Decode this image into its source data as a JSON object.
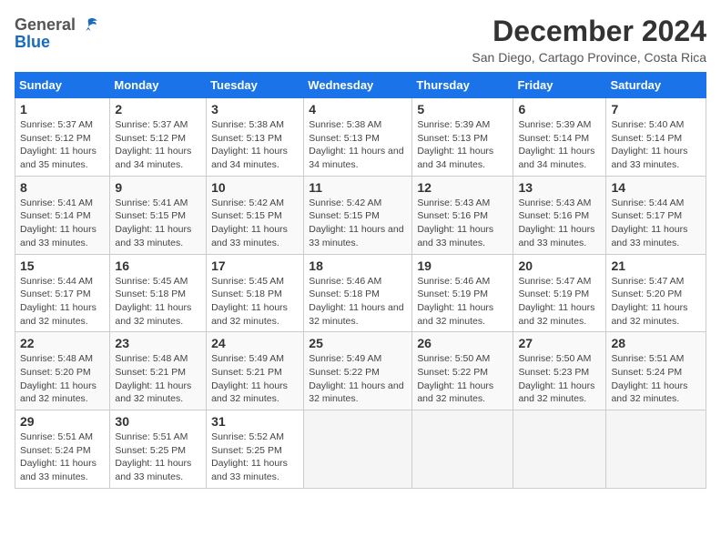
{
  "header": {
    "logo_line1": "General",
    "logo_line2": "Blue",
    "title": "December 2024",
    "subtitle": "San Diego, Cartago Province, Costa Rica"
  },
  "calendar": {
    "days_of_week": [
      "Sunday",
      "Monday",
      "Tuesday",
      "Wednesday",
      "Thursday",
      "Friday",
      "Saturday"
    ],
    "weeks": [
      [
        {
          "day": "1",
          "sunrise": "Sunrise: 5:37 AM",
          "sunset": "Sunset: 5:12 PM",
          "daylight": "Daylight: 11 hours and 35 minutes."
        },
        {
          "day": "2",
          "sunrise": "Sunrise: 5:37 AM",
          "sunset": "Sunset: 5:12 PM",
          "daylight": "Daylight: 11 hours and 34 minutes."
        },
        {
          "day": "3",
          "sunrise": "Sunrise: 5:38 AM",
          "sunset": "Sunset: 5:13 PM",
          "daylight": "Daylight: 11 hours and 34 minutes."
        },
        {
          "day": "4",
          "sunrise": "Sunrise: 5:38 AM",
          "sunset": "Sunset: 5:13 PM",
          "daylight": "Daylight: 11 hours and 34 minutes."
        },
        {
          "day": "5",
          "sunrise": "Sunrise: 5:39 AM",
          "sunset": "Sunset: 5:13 PM",
          "daylight": "Daylight: 11 hours and 34 minutes."
        },
        {
          "day": "6",
          "sunrise": "Sunrise: 5:39 AM",
          "sunset": "Sunset: 5:14 PM",
          "daylight": "Daylight: 11 hours and 34 minutes."
        },
        {
          "day": "7",
          "sunrise": "Sunrise: 5:40 AM",
          "sunset": "Sunset: 5:14 PM",
          "daylight": "Daylight: 11 hours and 33 minutes."
        }
      ],
      [
        {
          "day": "8",
          "sunrise": "Sunrise: 5:41 AM",
          "sunset": "Sunset: 5:14 PM",
          "daylight": "Daylight: 11 hours and 33 minutes."
        },
        {
          "day": "9",
          "sunrise": "Sunrise: 5:41 AM",
          "sunset": "Sunset: 5:15 PM",
          "daylight": "Daylight: 11 hours and 33 minutes."
        },
        {
          "day": "10",
          "sunrise": "Sunrise: 5:42 AM",
          "sunset": "Sunset: 5:15 PM",
          "daylight": "Daylight: 11 hours and 33 minutes."
        },
        {
          "day": "11",
          "sunrise": "Sunrise: 5:42 AM",
          "sunset": "Sunset: 5:15 PM",
          "daylight": "Daylight: 11 hours and 33 minutes."
        },
        {
          "day": "12",
          "sunrise": "Sunrise: 5:43 AM",
          "sunset": "Sunset: 5:16 PM",
          "daylight": "Daylight: 11 hours and 33 minutes."
        },
        {
          "day": "13",
          "sunrise": "Sunrise: 5:43 AM",
          "sunset": "Sunset: 5:16 PM",
          "daylight": "Daylight: 11 hours and 33 minutes."
        },
        {
          "day": "14",
          "sunrise": "Sunrise: 5:44 AM",
          "sunset": "Sunset: 5:17 PM",
          "daylight": "Daylight: 11 hours and 33 minutes."
        }
      ],
      [
        {
          "day": "15",
          "sunrise": "Sunrise: 5:44 AM",
          "sunset": "Sunset: 5:17 PM",
          "daylight": "Daylight: 11 hours and 32 minutes."
        },
        {
          "day": "16",
          "sunrise": "Sunrise: 5:45 AM",
          "sunset": "Sunset: 5:18 PM",
          "daylight": "Daylight: 11 hours and 32 minutes."
        },
        {
          "day": "17",
          "sunrise": "Sunrise: 5:45 AM",
          "sunset": "Sunset: 5:18 PM",
          "daylight": "Daylight: 11 hours and 32 minutes."
        },
        {
          "day": "18",
          "sunrise": "Sunrise: 5:46 AM",
          "sunset": "Sunset: 5:18 PM",
          "daylight": "Daylight: 11 hours and 32 minutes."
        },
        {
          "day": "19",
          "sunrise": "Sunrise: 5:46 AM",
          "sunset": "Sunset: 5:19 PM",
          "daylight": "Daylight: 11 hours and 32 minutes."
        },
        {
          "day": "20",
          "sunrise": "Sunrise: 5:47 AM",
          "sunset": "Sunset: 5:19 PM",
          "daylight": "Daylight: 11 hours and 32 minutes."
        },
        {
          "day": "21",
          "sunrise": "Sunrise: 5:47 AM",
          "sunset": "Sunset: 5:20 PM",
          "daylight": "Daylight: 11 hours and 32 minutes."
        }
      ],
      [
        {
          "day": "22",
          "sunrise": "Sunrise: 5:48 AM",
          "sunset": "Sunset: 5:20 PM",
          "daylight": "Daylight: 11 hours and 32 minutes."
        },
        {
          "day": "23",
          "sunrise": "Sunrise: 5:48 AM",
          "sunset": "Sunset: 5:21 PM",
          "daylight": "Daylight: 11 hours and 32 minutes."
        },
        {
          "day": "24",
          "sunrise": "Sunrise: 5:49 AM",
          "sunset": "Sunset: 5:21 PM",
          "daylight": "Daylight: 11 hours and 32 minutes."
        },
        {
          "day": "25",
          "sunrise": "Sunrise: 5:49 AM",
          "sunset": "Sunset: 5:22 PM",
          "daylight": "Daylight: 11 hours and 32 minutes."
        },
        {
          "day": "26",
          "sunrise": "Sunrise: 5:50 AM",
          "sunset": "Sunset: 5:22 PM",
          "daylight": "Daylight: 11 hours and 32 minutes."
        },
        {
          "day": "27",
          "sunrise": "Sunrise: 5:50 AM",
          "sunset": "Sunset: 5:23 PM",
          "daylight": "Daylight: 11 hours and 32 minutes."
        },
        {
          "day": "28",
          "sunrise": "Sunrise: 5:51 AM",
          "sunset": "Sunset: 5:24 PM",
          "daylight": "Daylight: 11 hours and 32 minutes."
        }
      ],
      [
        {
          "day": "29",
          "sunrise": "Sunrise: 5:51 AM",
          "sunset": "Sunset: 5:24 PM",
          "daylight": "Daylight: 11 hours and 33 minutes."
        },
        {
          "day": "30",
          "sunrise": "Sunrise: 5:51 AM",
          "sunset": "Sunset: 5:25 PM",
          "daylight": "Daylight: 11 hours and 33 minutes."
        },
        {
          "day": "31",
          "sunrise": "Sunrise: 5:52 AM",
          "sunset": "Sunset: 5:25 PM",
          "daylight": "Daylight: 11 hours and 33 minutes."
        },
        {
          "day": "",
          "sunrise": "",
          "sunset": "",
          "daylight": ""
        },
        {
          "day": "",
          "sunrise": "",
          "sunset": "",
          "daylight": ""
        },
        {
          "day": "",
          "sunrise": "",
          "sunset": "",
          "daylight": ""
        },
        {
          "day": "",
          "sunrise": "",
          "sunset": "",
          "daylight": ""
        }
      ]
    ]
  }
}
